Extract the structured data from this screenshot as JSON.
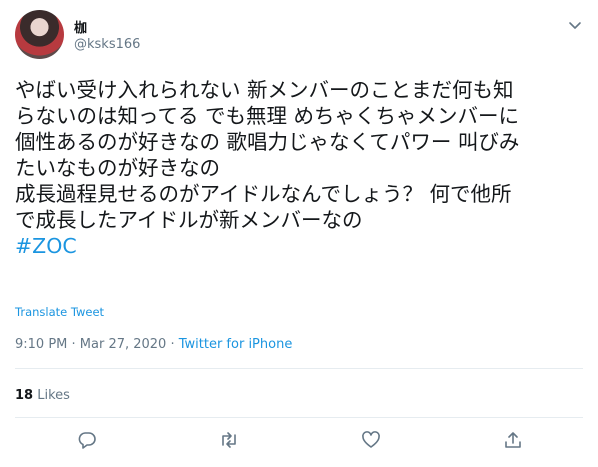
{
  "user": {
    "display_name": "枷",
    "handle": "@ksks166"
  },
  "tweet": {
    "lines": [
      "やばい受け入れられない 新メンバーのことまだ何も知",
      "らないのは知ってる でも無理 めちゃくちゃメンバーに",
      "個性あるのが好きなの 歌唱力じゃなくてパワー 叫びみ",
      "たいなものが好きなの",
      "成長過程見せるのがアイドルなんでしょう？ 何で他所",
      "で成長したアイドルが新メンバーなの"
    ],
    "hashtag": "#ZOC"
  },
  "translate_label": "Translate Tweet",
  "meta": {
    "timestamp": "9:10 PM · Mar 27, 2020 · ",
    "source": "Twitter for iPhone"
  },
  "stats": {
    "likes_count": "18",
    "likes_label": "Likes"
  },
  "icons": {
    "caret": "chevron-down-icon",
    "reply": "reply-icon",
    "retweet": "retweet-icon",
    "like": "heart-icon",
    "share": "share-icon"
  },
  "colors": {
    "accent": "#1b95e0",
    "secondary_text": "#657786",
    "divider": "#e6ecf0"
  }
}
